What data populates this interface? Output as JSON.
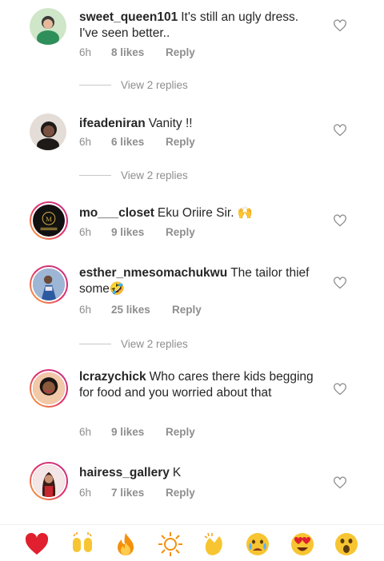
{
  "comments": [
    {
      "username": "sweet_queen101",
      "text": "It's still an ugly dress. I've seen better..",
      "time": "6h",
      "likes": "8 likes",
      "reply": "Reply",
      "view_replies": "View 2 replies"
    },
    {
      "username": "ifeadeniran",
      "text": "Vanity !!",
      "time": "6h",
      "likes": "6 likes",
      "reply": "Reply",
      "view_replies": "View 2 replies"
    },
    {
      "username": "mo___closet",
      "text": "Eku Oriire Sir. 🙌",
      "time": "6h",
      "likes": "9 likes",
      "reply": "Reply"
    },
    {
      "username": "esther_nmesomachukwu",
      "text": "The tailor thief some🤣",
      "time": "6h",
      "likes": "25 likes",
      "reply": "Reply",
      "view_replies": "View 2 replies"
    },
    {
      "username": "lcrazychick",
      "text": "Who cares there kids begging for food and you worried about that",
      "time": "6h",
      "likes": "9 likes",
      "reply": "Reply"
    },
    {
      "username": "hairess_gallery",
      "text": "K",
      "time": "6h",
      "likes": "7 likes",
      "reply": "Reply"
    }
  ],
  "emoji_bar": [
    {
      "icon": "red-heart-emoji"
    },
    {
      "icon": "raising-hands-emoji"
    },
    {
      "icon": "fire-emoji"
    },
    {
      "icon": "sun-emoji"
    },
    {
      "icon": "clapping-hands-emoji"
    },
    {
      "icon": "crying-face-emoji"
    },
    {
      "icon": "heart-eyes-emoji"
    },
    {
      "icon": "astonished-face-emoji"
    }
  ],
  "colors": {
    "text": "#262626",
    "secondary": "#8e8e8e",
    "story_ring": "#e1306c"
  }
}
